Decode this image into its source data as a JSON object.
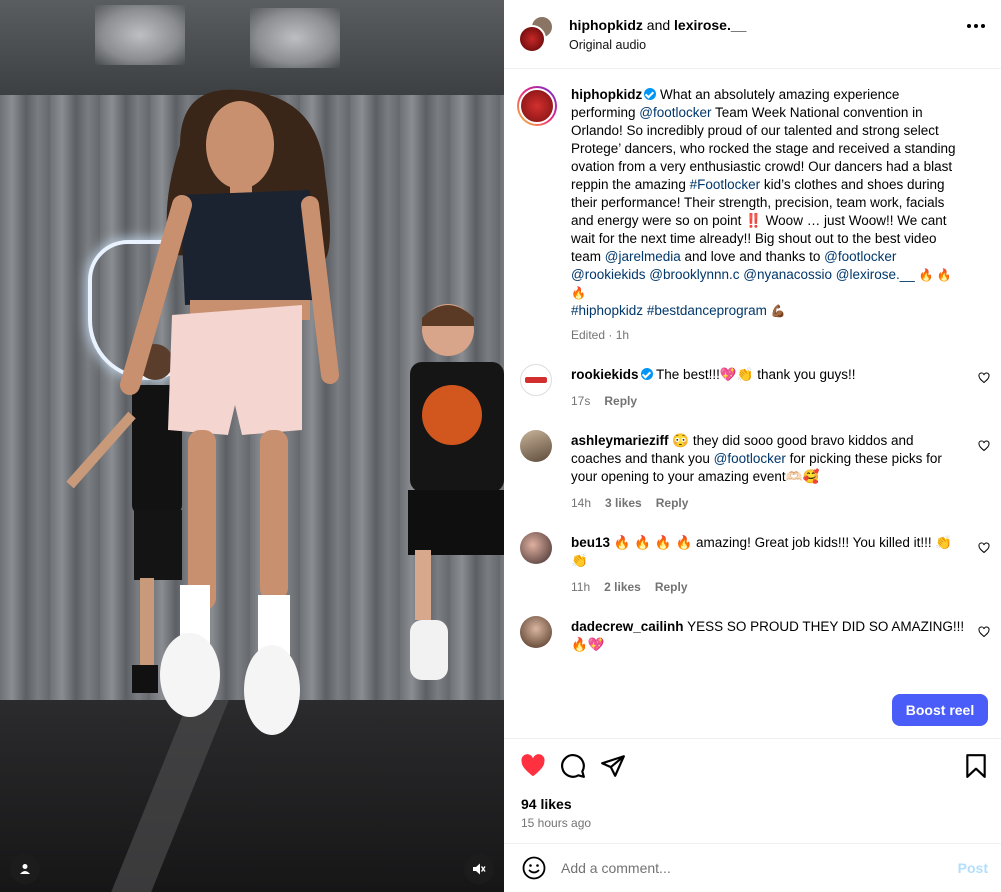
{
  "header": {
    "user1": "hiphopkidz",
    "and": "and",
    "user2": "lexirose.__",
    "audio": "Original audio"
  },
  "caption": {
    "username": "hiphopkidz",
    "p1": "What an absolutely amazing experience performing ",
    "m1": "@footlocker",
    "p2": " Team Week National convention in Orlando! So incredibly proud of our talented and strong select Protege’ dancers, who rocked the stage and received a standing ovation from a very enthusiastic crowd! Our dancers had a blast reppin the amazing ",
    "m2": "#Footlocker",
    "p3": " kid’s clothes and shoes during their performance! Their strength, precision, team work, facials and energy were so on point ‼️ Woow … just Woow!! We cant wait for the next time already!! Big shout out to the best video team ",
    "m3": "@jarelmedia",
    "p4": " and love and thanks to ",
    "m4": "@footlocker",
    "m5": "@rookiekids",
    "m6": "@brooklynnn.c",
    "m7": "@nyanacossio",
    "m8": "@lexirose.__",
    "fires": "🔥 🔥 🔥",
    "m9": "#hiphopkidz",
    "m10": "#bestdanceprogram",
    "flex": "💪🏾",
    "edited": "Edited · 1h"
  },
  "comments": [
    {
      "username": "rookiekids",
      "verified": true,
      "text": "The best!!!💖👏 thank you guys!!",
      "time": "17s",
      "likes": "",
      "reply": "Reply"
    },
    {
      "username": "ashleymarieziff",
      "verified": false,
      "text_a": "😳 they did sooo good bravo kiddos and coaches and thank you ",
      "mention": "@footlocker",
      "text_b": " for picking these picks for your opening to your amazing event🫶🏻🥰",
      "time": "14h",
      "likes": "3 likes",
      "reply": "Reply"
    },
    {
      "username": "beu13",
      "verified": false,
      "text": "🔥 🔥 🔥 🔥 amazing! Great job kids!!! You killed it!!! 👏👏",
      "time": "11h",
      "likes": "2 likes",
      "reply": "Reply"
    },
    {
      "username": "dadecrew_cailinh",
      "verified": false,
      "text": "YESS SO PROUD THEY DID SO AMAZING!!! 🔥💖",
      "time": "",
      "likes": "",
      "reply": ""
    }
  ],
  "boost_label": "Boost reel",
  "likes_count": "94 likes",
  "posted_ago": "15 hours ago",
  "comment_input": {
    "placeholder": "Add a comment...",
    "post_label": "Post"
  },
  "colors": {
    "like_red": "#ff3040",
    "link": "#00376b",
    "boost": "#4a5df9",
    "muted": "#737373"
  },
  "icons": [
    "heart-icon",
    "comment-icon",
    "share-icon",
    "bookmark-icon",
    "emoji-icon",
    "more-icon",
    "mute-icon",
    "user-tag-icon"
  ]
}
